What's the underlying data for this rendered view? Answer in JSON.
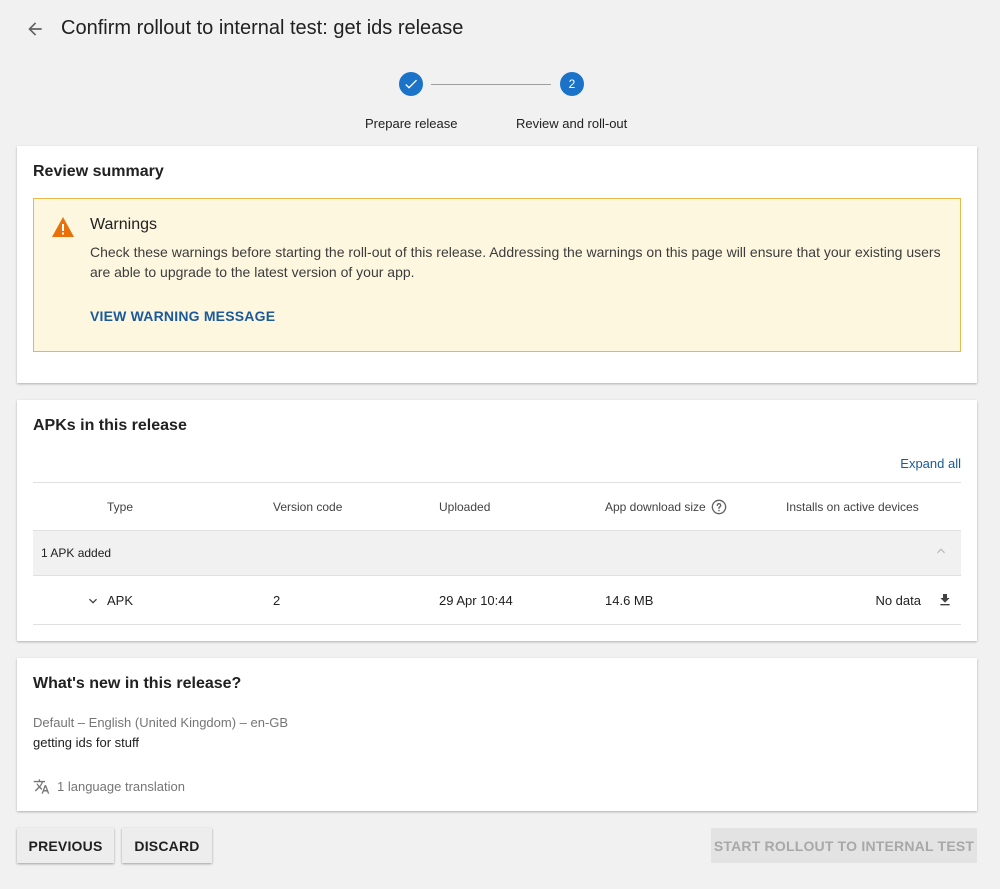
{
  "header": {
    "title": "Confirm rollout to internal test: get ids release"
  },
  "stepper": {
    "steps": [
      {
        "label": "Prepare release",
        "marker": "",
        "state": "completed"
      },
      {
        "label": "Review and roll-out",
        "marker": "2",
        "state": "active"
      }
    ]
  },
  "review_summary": {
    "title": "Review summary",
    "warning": {
      "title": "Warnings",
      "text": "Check these warnings before starting the roll-out of this release. Addressing the warnings on this page will ensure that your existing users are able to upgrade to the latest version of your app.",
      "link_label": "VIEW WARNING MESSAGE"
    }
  },
  "apks": {
    "title": "APKs in this release",
    "expand_all": "Expand all",
    "columns": [
      "Type",
      "Version code",
      "Uploaded",
      "App download size",
      "Installs on active devices"
    ],
    "group_label": "1 APK added",
    "rows": [
      {
        "type": "APK",
        "version_code": "2",
        "uploaded": "29 Apr 10:44",
        "size": "14.6 MB",
        "installs": "No data"
      }
    ]
  },
  "whats_new": {
    "title": "What's new in this release?",
    "language": "Default – English (United Kingdom) – en-GB",
    "notes": "getting ids for stuff",
    "translations": "1 language translation"
  },
  "footer": {
    "previous": "PREVIOUS",
    "discard": "DISCARD",
    "start": "START ROLLOUT TO INTERNAL TEST"
  },
  "colors": {
    "accent": "#1a73c8",
    "link": "#1a5a9c",
    "warning_bg": "#fef7e0",
    "warning_border": "#e5b94c",
    "warning_icon": "#e8710a"
  }
}
